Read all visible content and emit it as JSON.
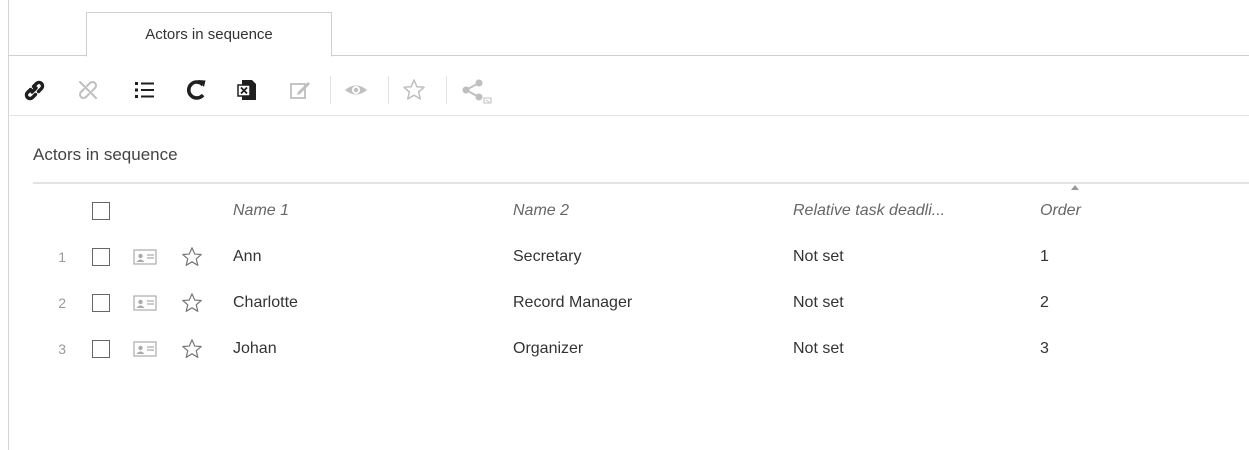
{
  "tab": {
    "label": "Actors in sequence"
  },
  "toolbar": {
    "icons": [
      "link-icon",
      "unlink-icon",
      "list-icon",
      "refresh-icon",
      "excel-export-icon",
      "edit-icon",
      "view-icon",
      "favorite-icon",
      "share-icon"
    ]
  },
  "section": {
    "title": "Actors in sequence"
  },
  "table": {
    "columns": [
      "Name 1",
      "Name 2",
      "Relative task deadli...",
      "Order"
    ],
    "sort_column": "Order",
    "rows": [
      {
        "index": "1",
        "name1": "Ann",
        "name2": "Secretary",
        "deadline": "Not set",
        "order": "1"
      },
      {
        "index": "2",
        "name1": "Charlotte",
        "name2": "Record Manager",
        "deadline": "Not set",
        "order": "2"
      },
      {
        "index": "3",
        "name1": "Johan",
        "name2": "Organizer",
        "deadline": "Not set",
        "order": "3"
      }
    ]
  },
  "colors": {
    "icon_active": "#1f1f1f",
    "icon_disabled": "#bfbfbf",
    "border": "#cfcfcf"
  }
}
